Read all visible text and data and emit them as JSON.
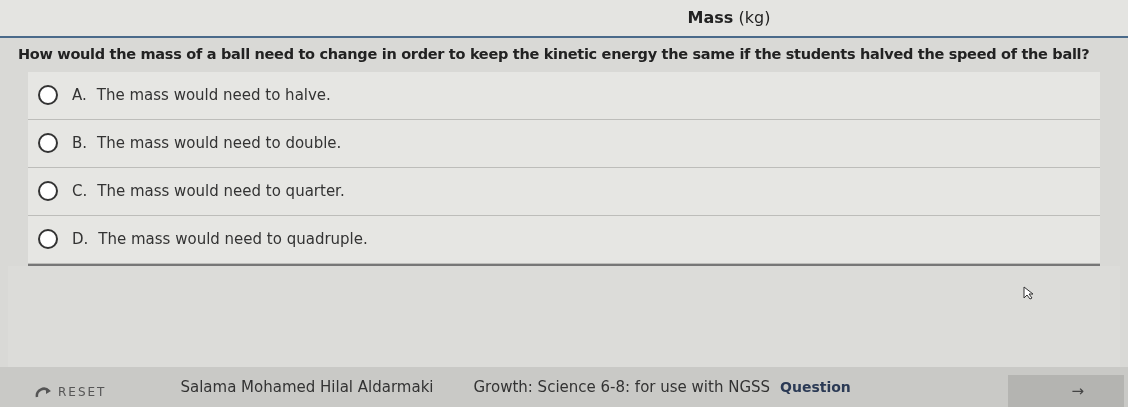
{
  "header": {
    "column_label": "**Mass** (kg)"
  },
  "question": "How would the mass of a ball need to change in order to keep the kinetic energy the same if the students halved the speed of the ball?",
  "options": [
    {
      "letter": "A.",
      "text": "The mass would need to halve.",
      "selected": false
    },
    {
      "letter": "B.",
      "text": "The mass would need to double.",
      "selected": false
    },
    {
      "letter": "C.",
      "text": "The mass would need to quarter.",
      "selected": false
    },
    {
      "letter": "D.",
      "text": "The mass would need to quadruple.",
      "selected": false
    }
  ],
  "footer": {
    "reset": "RESET",
    "student": "Salama Mohamed Hilal Aldarmaki",
    "course": "Growth: Science 6-8: for use with NGSS",
    "section": "Question",
    "next": "→"
  }
}
